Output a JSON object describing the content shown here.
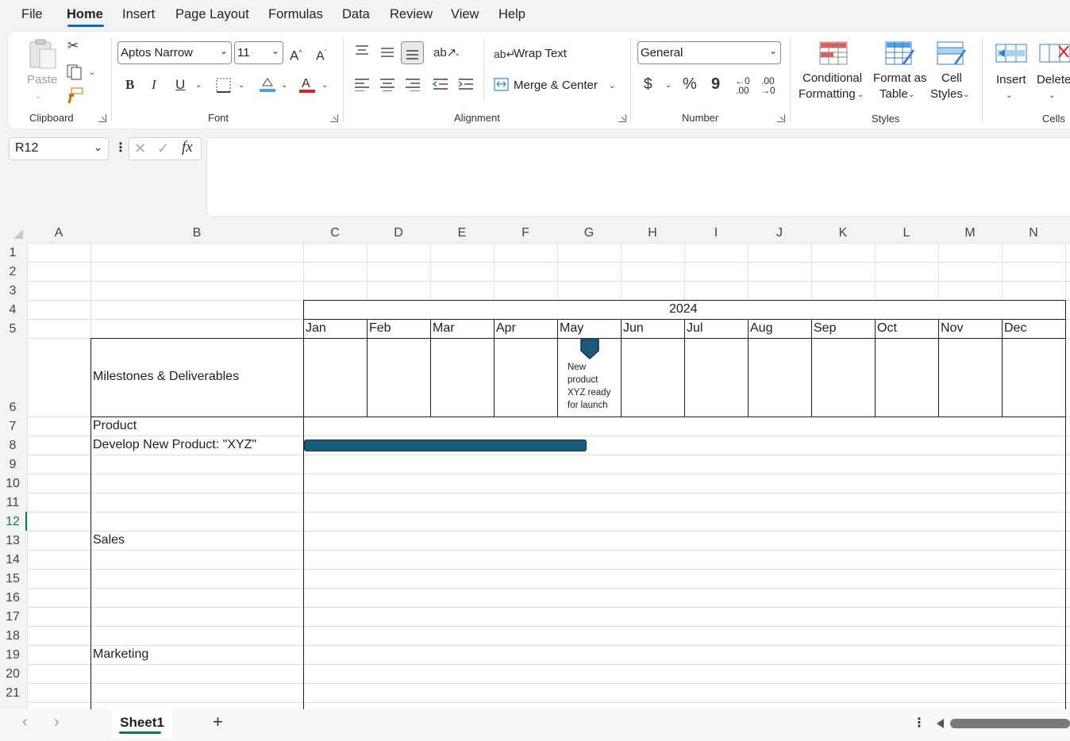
{
  "menu": [
    "File",
    "Home",
    "Insert",
    "Page Layout",
    "Formulas",
    "Data",
    "Review",
    "View",
    "Help"
  ],
  "clipboard": {
    "paste": "Paste",
    "group": "Clipboard"
  },
  "font": {
    "name": "Aptos Narrow",
    "size": "11",
    "group": "Font",
    "bold": "B",
    "italic": "I",
    "underline": "U"
  },
  "alignment": {
    "wrap": "Wrap Text",
    "merge": "Merge & Center",
    "group": "Alignment"
  },
  "number": {
    "format": "General",
    "currency": "$",
    "percent": "%",
    "comma": "9",
    "group": "Number"
  },
  "styles": {
    "conditional1": "Conditional",
    "conditional2": "Formatting",
    "format1": "Format as",
    "format2": "Table",
    "cell1": "Cell",
    "cell2": "Styles",
    "group": "Styles"
  },
  "cells": {
    "insert": "Insert",
    "delete": "Delete",
    "group": "Cells"
  },
  "namebox": "R12",
  "fx": "fx",
  "columns": [
    "A",
    "B",
    "C",
    "D",
    "E",
    "F",
    "G",
    "H",
    "I",
    "J",
    "K",
    "L",
    "M",
    "N"
  ],
  "rows": [
    "1",
    "2",
    "3",
    "4",
    "5",
    "6",
    "7",
    "8",
    "9",
    "10",
    "11",
    "12",
    "13",
    "14",
    "15",
    "16",
    "17",
    "18",
    "19",
    "20",
    "21"
  ],
  "sheet": {
    "year": "2024",
    "months": [
      "Jan",
      "Feb",
      "Mar",
      "Apr",
      "May",
      "Jun",
      "Jul",
      "Aug",
      "Sep",
      "Oct",
      "Nov",
      "Dec"
    ],
    "b6": "Milestones & Deliverables",
    "b7": "Product",
    "b8": "Develop New Product: \"XYZ\"",
    "b13": "Sales",
    "b19": "Marketing",
    "milestone": [
      "New",
      "product",
      "XYZ ready",
      "for launch"
    ],
    "bar_color": "#1b5a78"
  },
  "tabs": {
    "active": "Sheet1",
    "add": "+"
  },
  "colors": {
    "accent": "#0f6cbd",
    "sheet_accent": "#107c41",
    "selected_row": "#107c41"
  }
}
